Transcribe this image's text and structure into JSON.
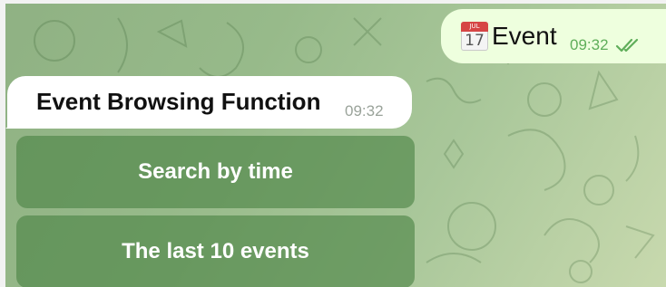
{
  "chat": {
    "outgoing_message": {
      "icon": "calendar-icon",
      "calendar_month": "JUL",
      "calendar_day": "17",
      "text": "Event",
      "time": "09:32",
      "status_icon": "double-check-icon"
    },
    "incoming_message": {
      "text": "Event Browsing Function",
      "time": "09:32"
    },
    "keyboard_buttons": [
      {
        "label": "Search by time"
      },
      {
        "label": "The last 10 events"
      }
    ]
  },
  "colors": {
    "background": "#97ba8a",
    "outgoing_bubble": "#eeffde",
    "incoming_bubble": "#ffffff",
    "button": "#4a8244",
    "outgoing_time": "#5fae5a"
  }
}
